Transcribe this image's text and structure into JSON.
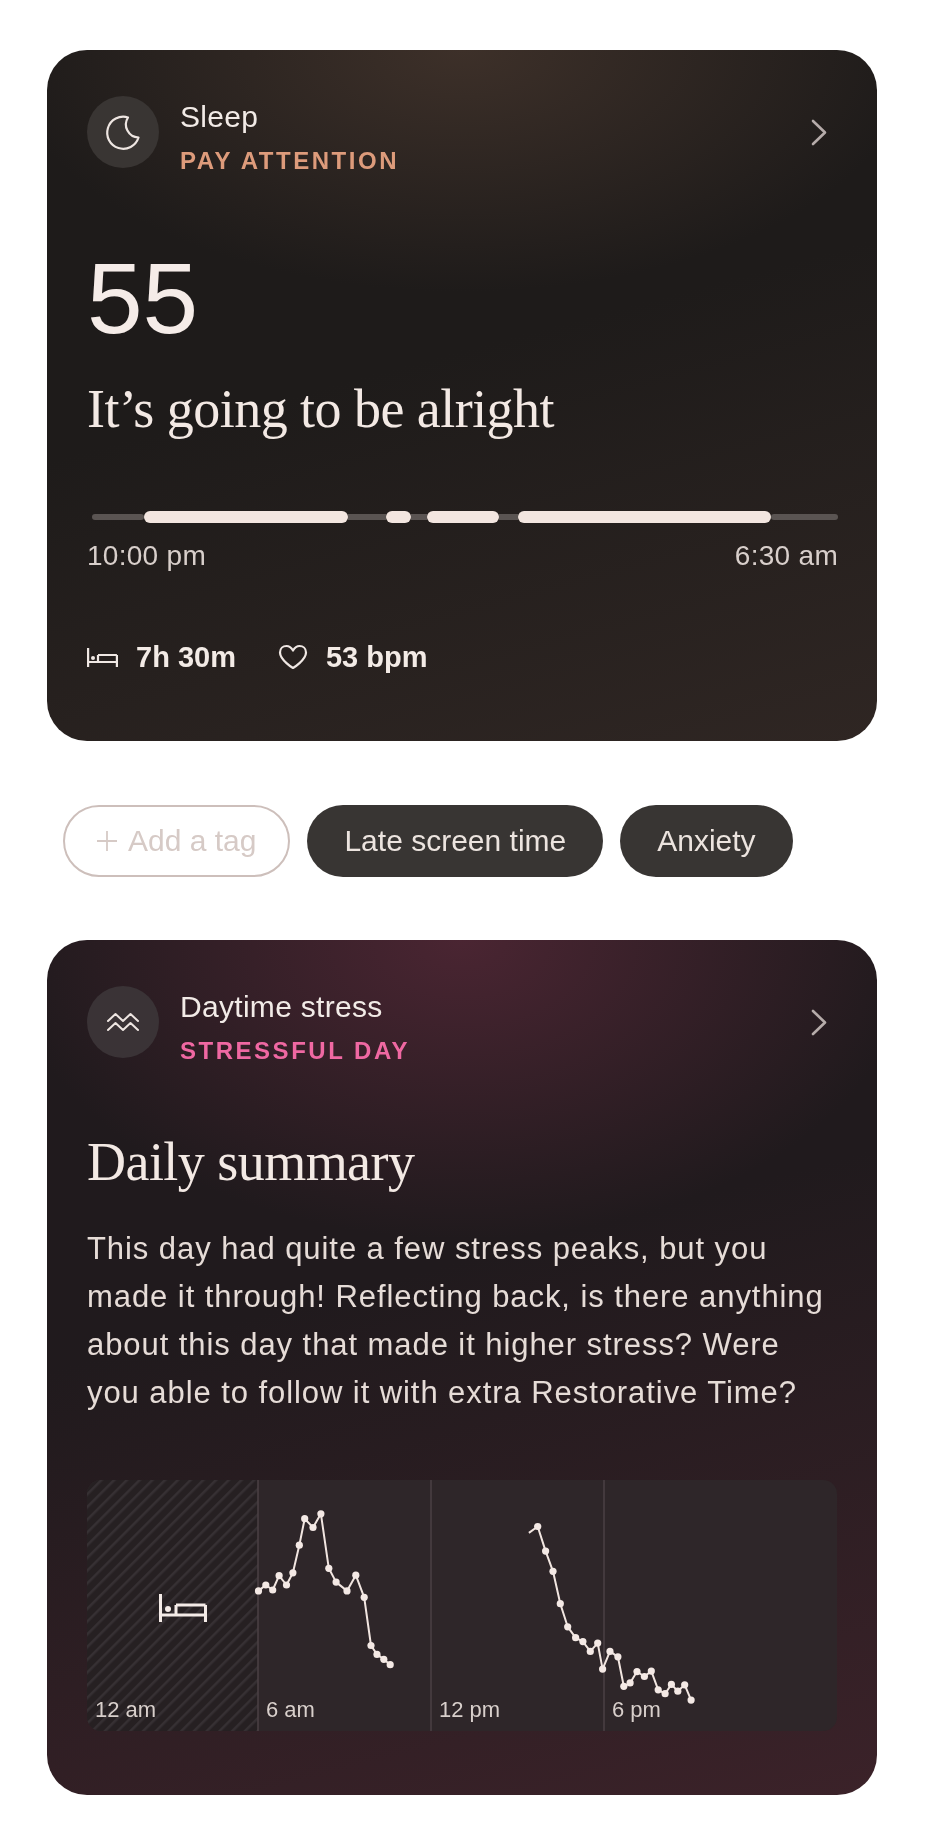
{
  "sleep_card": {
    "title": "Sleep",
    "status": "PAY ATTENTION",
    "score": "55",
    "headline": "It’s going to be alright",
    "timeline": {
      "start": "10:00 pm",
      "end": "6:30 am"
    },
    "stats": [
      {
        "kind": "duration",
        "value": "7h 30m"
      },
      {
        "kind": "heart_rate",
        "value": "53 bpm"
      }
    ]
  },
  "tags": [
    {
      "kind": "add",
      "label": "Add a tag"
    },
    {
      "kind": "tag",
      "label": "Late screen time"
    },
    {
      "kind": "tag",
      "label": "Anxiety"
    }
  ],
  "stress_card": {
    "title": "Daytime stress",
    "status": "STRESSFUL DAY",
    "heading": "Daily summary",
    "summary": "This day had quite a few stress peaks, but you made it through! Reflecting back, is there anything about this day that made it higher stress? Were you able to follow it with extra Restorative Time?",
    "chart": {
      "time_labels": [
        "12 am",
        "6 am",
        "12 pm",
        "6 pm"
      ]
    }
  }
}
